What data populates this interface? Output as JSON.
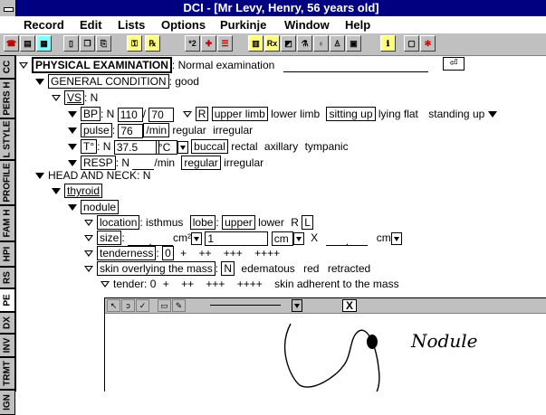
{
  "window": {
    "title": "DCI - [Mr Levy, Henry, 56 years old]"
  },
  "menu": [
    "Record",
    "Edit",
    "Lists",
    "Options",
    "Purkinje",
    "Window",
    "Help"
  ],
  "toolbar": {
    "buttons": [
      "phone-icon",
      "folder-icon",
      "open-icon",
      "page-icon",
      "copy-icon",
      "paste-icon",
      "key-icon",
      "rx-key-icon",
      "x2-icon",
      "plus-grid-icon",
      "list-icon",
      "ledger-icon",
      "rx-icon",
      "picture-icon",
      "lab-icon",
      "flask-icon",
      "person-icon",
      "book-icon",
      "info-icon",
      "window-icon",
      "tree-icon"
    ],
    "x2_label": "*2",
    "rx_label": "Rx"
  },
  "tabs": [
    {
      "label": "CC",
      "active": false
    },
    {
      "label": "PERS H",
      "active": false
    },
    {
      "label": "L STYLE",
      "active": false
    },
    {
      "label": "PROFILE",
      "active": false
    },
    {
      "label": "FAM H",
      "active": false
    },
    {
      "label": "HPI",
      "active": false
    },
    {
      "label": "RS",
      "active": false
    },
    {
      "label": "PE",
      "active": true
    },
    {
      "label": "DX",
      "active": false
    },
    {
      "label": "INV",
      "active": false
    },
    {
      "label": "TRMT",
      "active": false
    },
    {
      "label": "IGN",
      "active": false
    }
  ],
  "exam": {
    "header": "PHYSICAL EXAMINATION",
    "header_value": ": Normal examination",
    "general": "GENERAL CONDITION",
    "general_value": ": good",
    "vs": "VS",
    "vs_value": ": N",
    "bp": {
      "label": "BP",
      "n": ": N",
      "sys": "110",
      "slash": "/",
      "dia": "70",
      "r": "R",
      "opts": [
        "upper limb",
        "lower limb",
        "sitting up",
        "lying flat",
        "standing up"
      ]
    },
    "pulse": {
      "label": "pulse",
      "value": "76",
      "unit": "/min",
      "opts": [
        "regular",
        "irregular"
      ]
    },
    "temp": {
      "label": "T°",
      "n": ": N",
      "value": "37.5",
      "unit": "°C",
      "opts": [
        "buccal",
        "rectal",
        "axillary",
        "tympanic"
      ]
    },
    "resp": {
      "label": "RESP",
      "n": ": N",
      "unit": "/min",
      "opts": [
        "regular",
        "irregular"
      ]
    },
    "head": "HEAD AND NECK",
    "head_value": ": N",
    "thyroid": "thyroid",
    "nodule": "nodule",
    "location": {
      "label": "location",
      "value": ": isthmus",
      "lobe": "lobe",
      "opts": [
        "upper",
        "lower",
        "R",
        "L"
      ]
    },
    "size": {
      "label": "size",
      "dot": ".",
      "unit1": "cm²",
      "field": "1",
      "unit2": "cm",
      "x": "X",
      "dot2": ".",
      "unit3": "cm"
    },
    "tenderness": {
      "label": "tenderness",
      "value": "0",
      "opts": "+    ++    +++    ++++"
    },
    "skin": {
      "label": "skin overlying the mass",
      "value": "N",
      "opts": [
        "edematous",
        "red",
        "retracted"
      ]
    },
    "tender": {
      "label": "tender",
      "value": ": 0",
      "opts": "+    ++    +++    ++++",
      "extra": "skin adherent to the mass"
    }
  },
  "drawing": {
    "caption": "Nodule",
    "close": "X"
  }
}
